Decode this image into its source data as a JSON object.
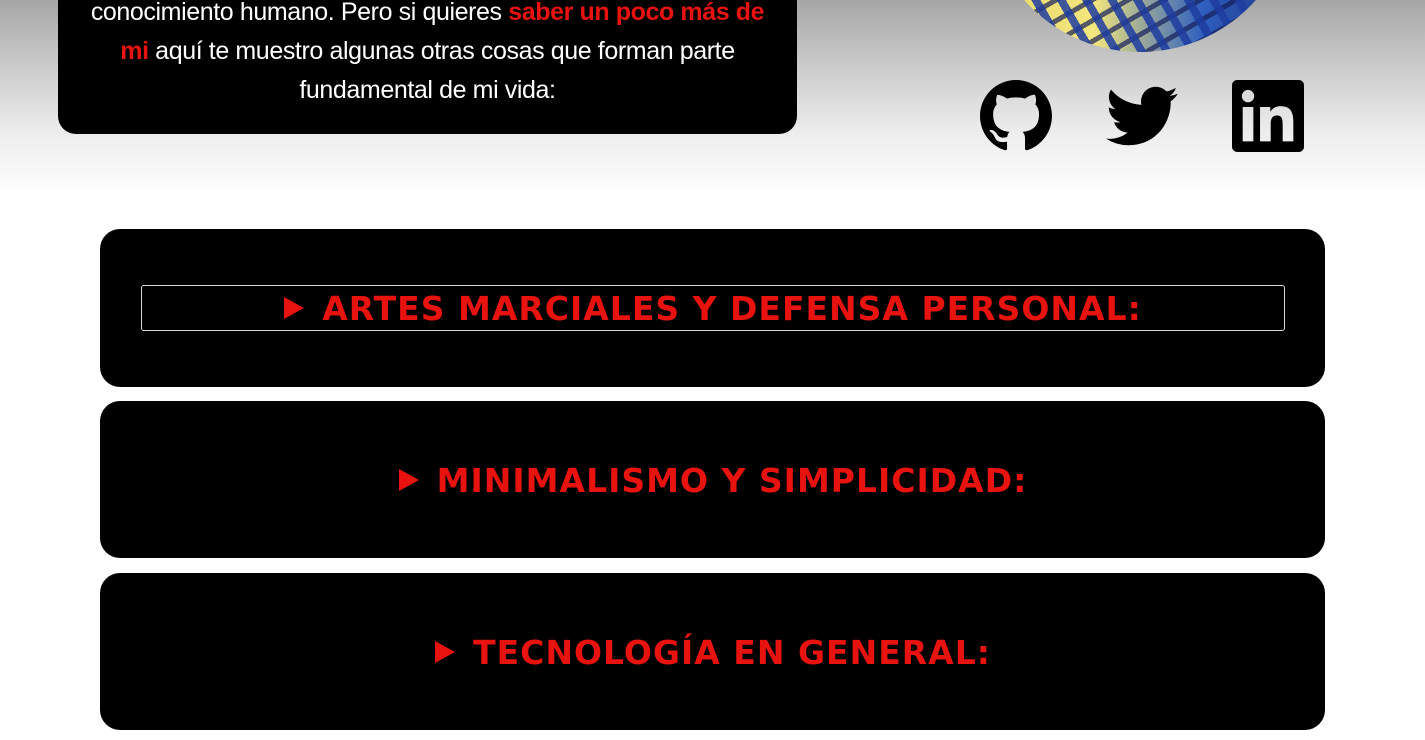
{
  "intro": {
    "line1_prefix": "conocimiento humano. Pero si quieres ",
    "highlight": "saber un poco más de mi",
    "line1_suffix": " aquí te muestro algunas otras cosas que forman parte fundamental de mi vida:"
  },
  "socials": [
    {
      "name": "GitHub",
      "icon": "github-icon"
    },
    {
      "name": "Twitter",
      "icon": "twitter-icon"
    },
    {
      "name": "LinkedIn",
      "icon": "linkedin-icon"
    }
  ],
  "sections": [
    {
      "label": "Artes marciales y defensa personal:",
      "expanded": false
    },
    {
      "label": "Minimalismo y simplicidad:",
      "expanded": false
    },
    {
      "label": "Tecnología en general:",
      "expanded": false
    }
  ],
  "colors": {
    "accent": "#e8130f",
    "card_bg": "#000000",
    "text": "#ffffff"
  }
}
